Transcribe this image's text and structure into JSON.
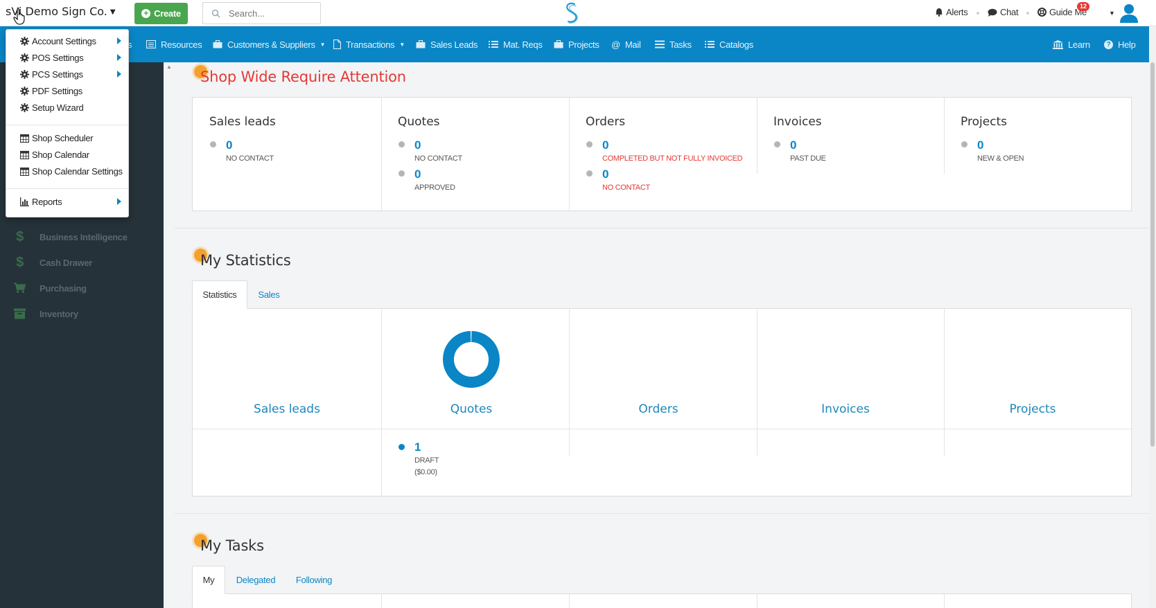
{
  "header": {
    "company": "sVi Demo Sign Co.",
    "create_label": "Create",
    "search_placeholder": "Search...",
    "alerts": "Alerts",
    "chat": "Chat",
    "guide": "Guide Me",
    "guide_badge": "12"
  },
  "nav": {
    "partial_label": "s",
    "items": [
      {
        "label": "Resources"
      },
      {
        "label": "Customers & Suppliers"
      },
      {
        "label": "Transactions"
      },
      {
        "label": "Sales Leads"
      },
      {
        "label": "Mat. Reqs"
      },
      {
        "label": "Projects"
      },
      {
        "label": "Mail"
      },
      {
        "label": "Tasks"
      },
      {
        "label": "Catalogs"
      }
    ],
    "learn": "Learn",
    "help": "Help"
  },
  "dropdown": {
    "items": [
      {
        "label": "Account Settings",
        "icon": "gear-icon",
        "submenu": true
      },
      {
        "label": "POS Settings",
        "icon": "gear-icon",
        "submenu": true
      },
      {
        "label": "PCS Settings",
        "icon": "gear-icon",
        "submenu": true
      },
      {
        "label": "PDF Settings",
        "icon": "gear-icon",
        "submenu": false
      },
      {
        "label": "Setup Wizard",
        "icon": "gear-icon",
        "submenu": false
      },
      {
        "label": "Shop Scheduler",
        "icon": "calendar-icon",
        "submenu": false
      },
      {
        "label": "Shop Calendar",
        "icon": "calendar-icon",
        "submenu": false
      },
      {
        "label": "Shop Calendar Settings",
        "icon": "calendar-icon",
        "submenu": false
      },
      {
        "label": "Reports",
        "icon": "bar-chart-icon",
        "submenu": true
      }
    ]
  },
  "sidebar": {
    "items": [
      {
        "label": "Business Intelligence",
        "icon": "dollar-icon"
      },
      {
        "label": "Cash Drawer",
        "icon": "dollar-icon"
      },
      {
        "label": "Purchasing",
        "icon": "cart-icon"
      },
      {
        "label": "Inventory",
        "icon": "archive-icon"
      }
    ]
  },
  "attention": {
    "title": "Shop Wide Require Attention",
    "cards": [
      {
        "title": "Sales leads",
        "stats": [
          {
            "value": "0",
            "label": "NO CONTACT",
            "alert": false
          }
        ]
      },
      {
        "title": "Quotes",
        "stats": [
          {
            "value": "0",
            "label": "NO CONTACT",
            "alert": false
          },
          {
            "value": "0",
            "label": "APPROVED",
            "alert": false
          }
        ]
      },
      {
        "title": "Orders",
        "stats": [
          {
            "value": "0",
            "label": "COMPLETED BUT NOT FULLY INVOICED",
            "alert": true
          },
          {
            "value": "0",
            "label": "NO CONTACT",
            "alert": true
          }
        ]
      },
      {
        "title": "Invoices",
        "stats": [
          {
            "value": "0",
            "label": "PAST DUE",
            "alert": false
          }
        ]
      },
      {
        "title": "Projects",
        "stats": [
          {
            "value": "0",
            "label": "NEW & OPEN",
            "alert": false
          }
        ]
      }
    ]
  },
  "statistics": {
    "title": "My Statistics",
    "tabs": [
      "Statistics",
      "Sales"
    ],
    "active_tab": "Statistics",
    "columns": [
      "Sales leads",
      "Quotes",
      "Orders",
      "Invoices",
      "Projects"
    ],
    "quotes_stat": {
      "value": "1",
      "label": "DRAFT",
      "amount": "($0.00)"
    }
  },
  "chart_data": {
    "type": "pie",
    "title": "Quotes",
    "categories": [
      "DRAFT"
    ],
    "values": [
      1
    ],
    "colors": [
      "#0a86c6"
    ],
    "donut": true
  },
  "tasks": {
    "title": "My Tasks",
    "tabs": [
      "My",
      "Delegated",
      "Following"
    ],
    "active_tab": "My"
  },
  "colors": {
    "accent": "#0a86c6",
    "create_green": "#4aa64e",
    "alert_red": "#e53935",
    "sidebar_bg": "#253239",
    "section_dot": "#f4a12b"
  }
}
